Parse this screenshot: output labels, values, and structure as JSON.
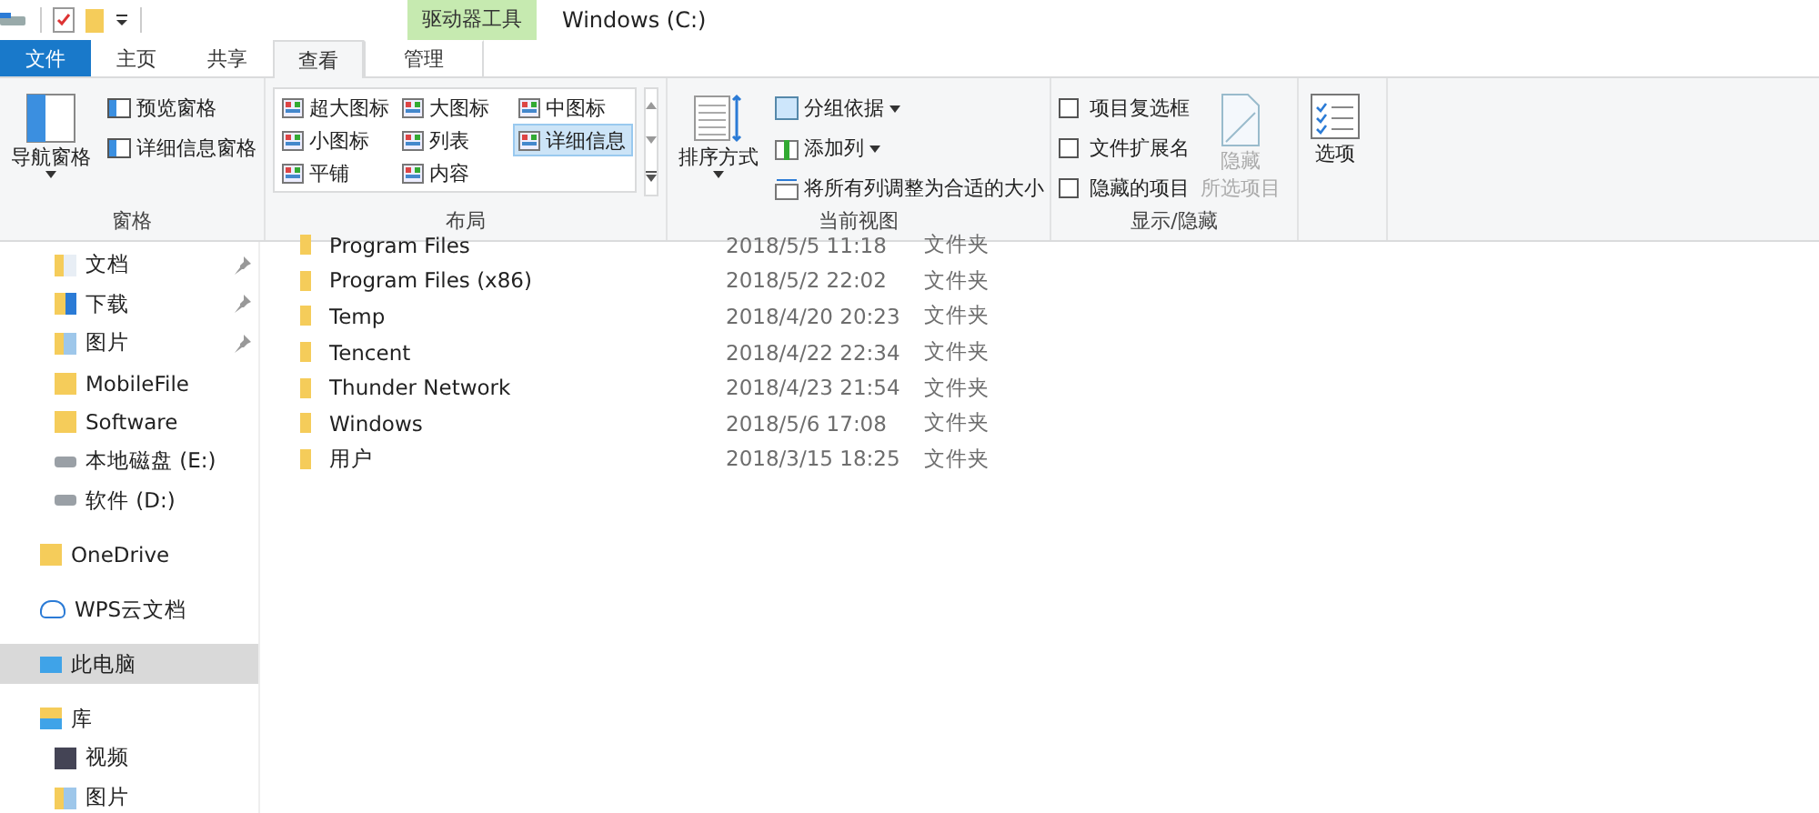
{
  "window": {
    "title": "Windows (C:)",
    "context_header": "驱动器工具"
  },
  "tabs": [
    {
      "label": "文件",
      "kind": "file",
      "selected": false
    },
    {
      "label": "主页",
      "kind": "tab",
      "selected": false
    },
    {
      "label": "共享",
      "kind": "tab",
      "selected": false
    },
    {
      "label": "查看",
      "kind": "tab",
      "selected": true
    },
    {
      "label": "管理",
      "kind": "context",
      "selected": false
    }
  ],
  "ribbon": {
    "panes": {
      "label": "窗格",
      "nav": "导航窗格",
      "preview": "预览窗格",
      "details": "详细信息窗格"
    },
    "layout": {
      "label": "布局",
      "items": [
        {
          "label": "超大图标",
          "selected": false
        },
        {
          "label": "大图标",
          "selected": false
        },
        {
          "label": "中图标",
          "selected": false
        },
        {
          "label": "小图标",
          "selected": false
        },
        {
          "label": "列表",
          "selected": false
        },
        {
          "label": "详细信息",
          "selected": true
        },
        {
          "label": "平铺",
          "selected": false
        },
        {
          "label": "内容",
          "selected": false
        }
      ]
    },
    "current_view": {
      "label": "当前视图",
      "sort": "排序方式",
      "group_by": "分组依据",
      "add_column": "添加列",
      "fit_columns": "将所有列调整为合适的大小"
    },
    "show_hide": {
      "label": "显示/隐藏",
      "checkboxes": [
        {
          "label": "项目复选框",
          "checked": false
        },
        {
          "label": "文件扩展名",
          "checked": false
        },
        {
          "label": "隐藏的项目",
          "checked": false
        }
      ],
      "hide_selected": {
        "line1": "隐藏",
        "line2": "所选项目",
        "disabled": true
      }
    },
    "options": {
      "label": "选项"
    }
  },
  "sidebar": {
    "quick_access": [
      {
        "label": "文档",
        "kind": "docs",
        "pinned": true
      },
      {
        "label": "下载",
        "kind": "download",
        "pinned": true
      },
      {
        "label": "图片",
        "kind": "pictures",
        "pinned": true
      },
      {
        "label": "MobileFile",
        "kind": "folder",
        "pinned": false
      },
      {
        "label": "Software",
        "kind": "folder",
        "pinned": false
      },
      {
        "label": "本地磁盘 (E:)",
        "kind": "drive",
        "pinned": false
      },
      {
        "label": "软件 (D:)",
        "kind": "drive",
        "pinned": false
      }
    ],
    "items": [
      {
        "label": "OneDrive",
        "kind": "folder",
        "selected": false
      },
      {
        "label": "WPS云文档",
        "kind": "cloud",
        "selected": false
      },
      {
        "label": "此电脑",
        "kind": "pc",
        "selected": true
      },
      {
        "label": "库",
        "kind": "library",
        "selected": false,
        "children": [
          {
            "label": "视频",
            "kind": "video",
            "selected": false
          },
          {
            "label": "图片",
            "kind": "pictures",
            "selected": false
          }
        ]
      }
    ]
  },
  "files": [
    {
      "name": "Program Files",
      "modified": "2018/5/5 11:18",
      "type": "文件夹"
    },
    {
      "name": "Program Files (x86)",
      "modified": "2018/5/2 22:02",
      "type": "文件夹"
    },
    {
      "name": "Temp",
      "modified": "2018/4/20 20:23",
      "type": "文件夹"
    },
    {
      "name": "Tencent",
      "modified": "2018/4/22 22:34",
      "type": "文件夹"
    },
    {
      "name": "Thunder Network",
      "modified": "2018/4/23 21:54",
      "type": "文件夹"
    },
    {
      "name": "Windows",
      "modified": "2018/5/6 17:08",
      "type": "文件夹"
    },
    {
      "name": "用户",
      "modified": "2018/3/15 18:25",
      "type": "文件夹"
    }
  ]
}
